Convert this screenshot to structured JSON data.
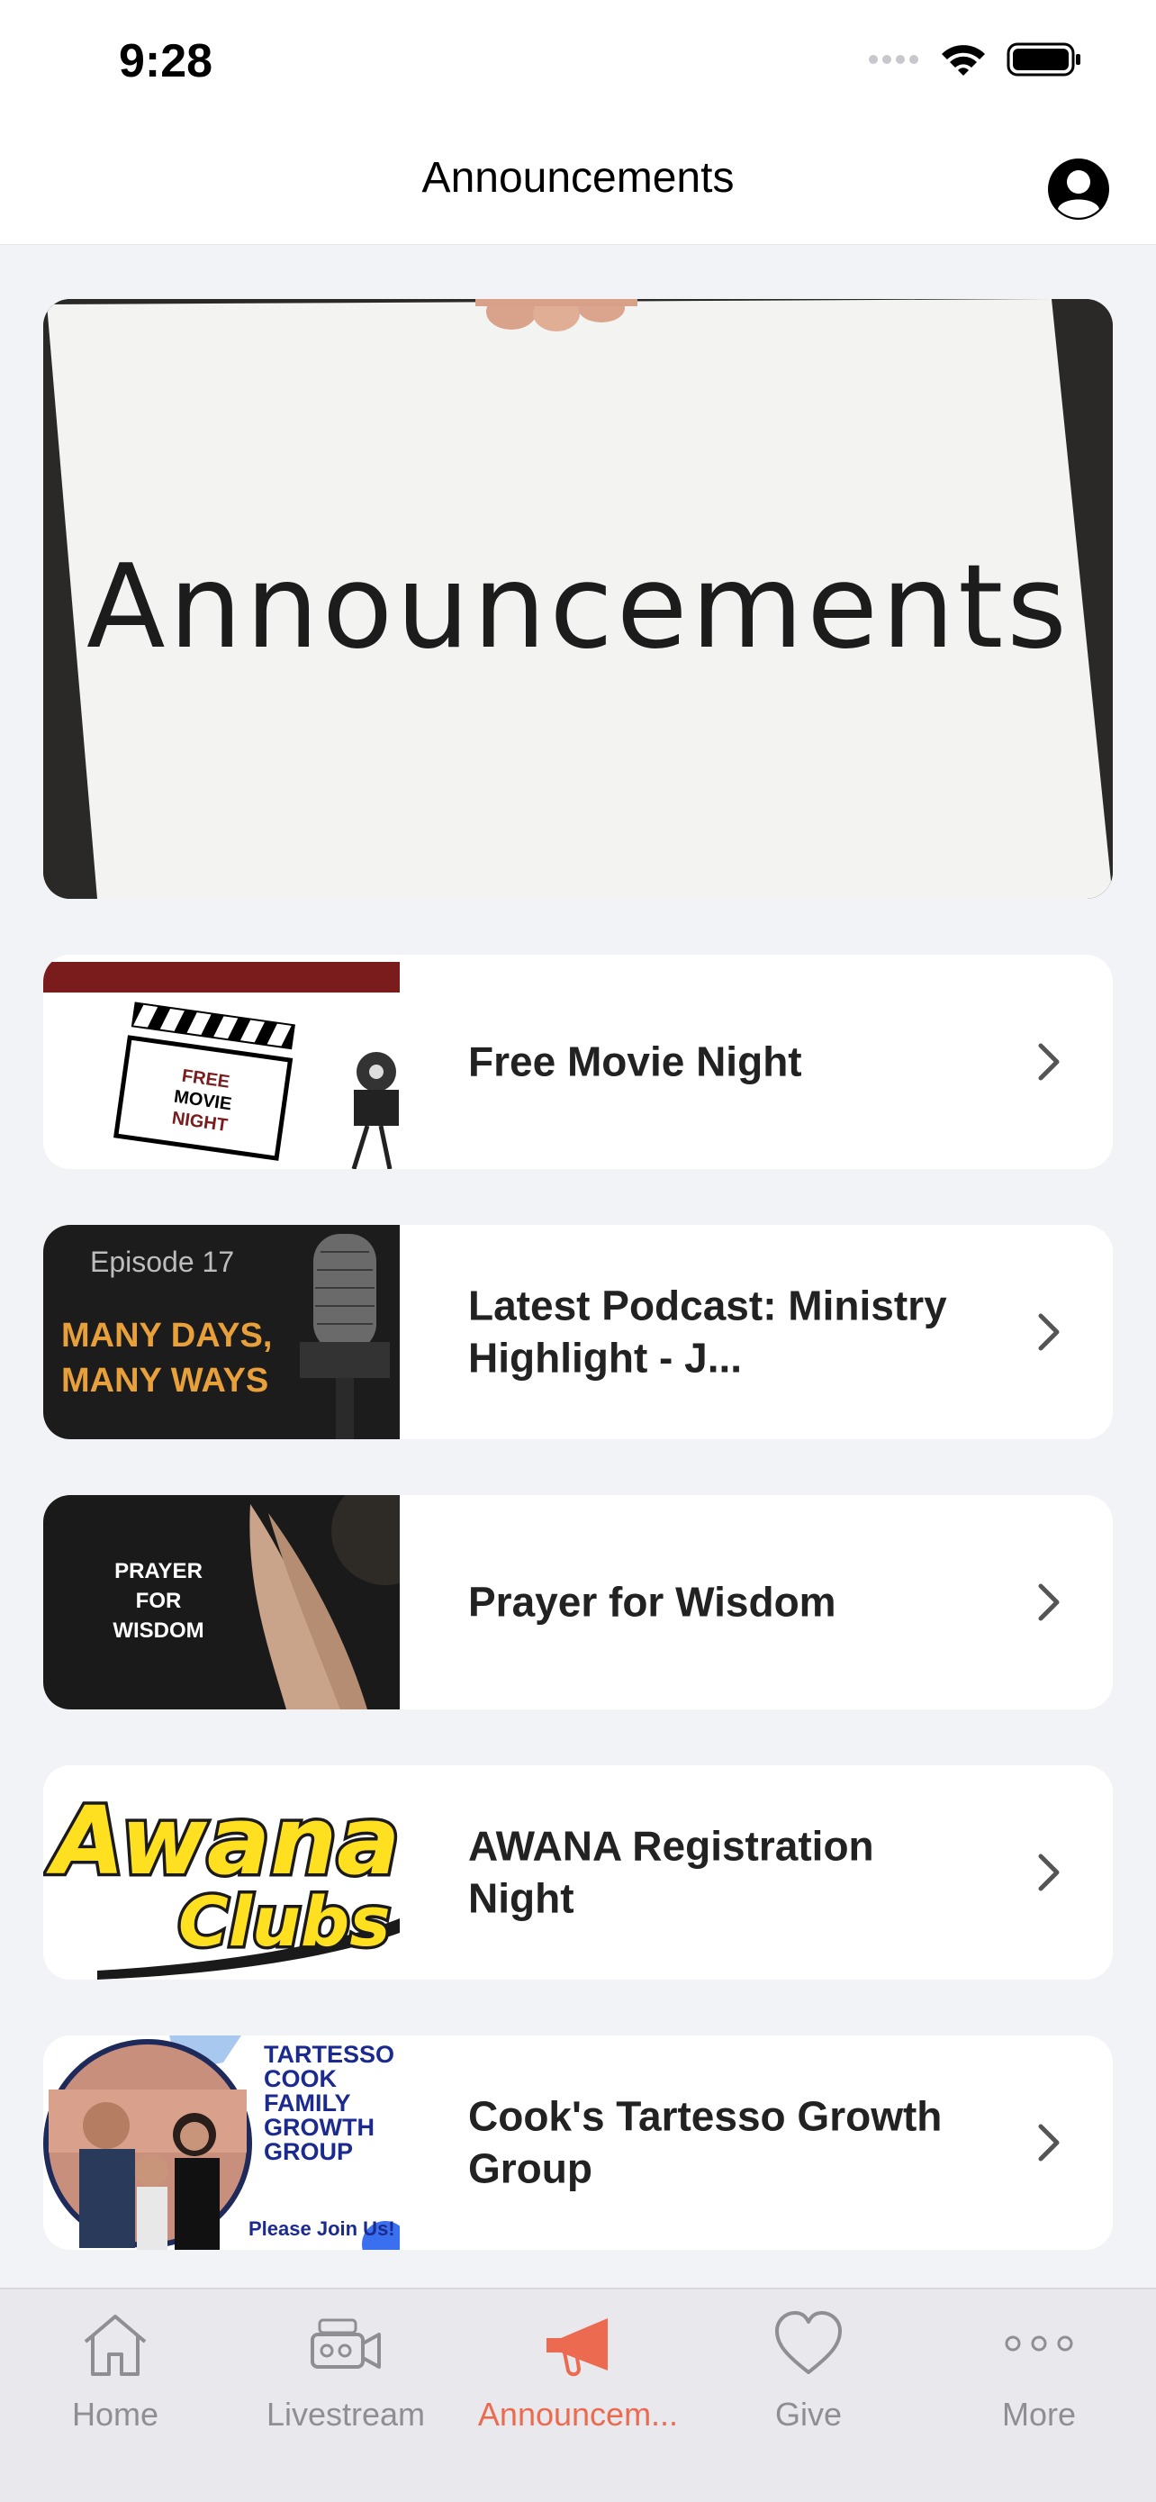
{
  "status_bar": {
    "time": "9:28"
  },
  "nav": {
    "title": "Announcements"
  },
  "hero": {
    "text": "Announcements"
  },
  "items": [
    {
      "title": "Free Movie Night",
      "thumb_lines": [
        "FREE",
        "MOVIE",
        "NIGHT"
      ]
    },
    {
      "title": "Latest Podcast: Ministry Highlight - J...",
      "thumb_episode": "Episode 17",
      "thumb_lines": [
        "MANY DAYS,",
        "MANY WAYS"
      ]
    },
    {
      "title": "Prayer for Wisdom",
      "thumb_lines": [
        "PRAYER",
        "FOR",
        "WISDOM"
      ]
    },
    {
      "title": "AWANA Registration Night",
      "thumb_lines": [
        "Awana",
        "Clubs"
      ]
    },
    {
      "title": "Cook's Tartesso Growth Group",
      "thumb_lines": [
        "TARTESSO",
        "COOK",
        "FAMILY",
        "GROWTH",
        "GROUP"
      ],
      "thumb_footer": "Please Join Us!"
    }
  ],
  "tabs": [
    {
      "label": "Home",
      "icon": "home-icon"
    },
    {
      "label": "Livestream",
      "icon": "video-camera-icon"
    },
    {
      "label": "Announcem...",
      "icon": "megaphone-icon",
      "active": true
    },
    {
      "label": "Give",
      "icon": "heart-icon"
    },
    {
      "label": "More",
      "icon": "more-dots-icon"
    }
  ],
  "colors": {
    "accent": "#ec6a50",
    "tab_inactive": "#8e8e93",
    "background": "#f2f3f7"
  }
}
